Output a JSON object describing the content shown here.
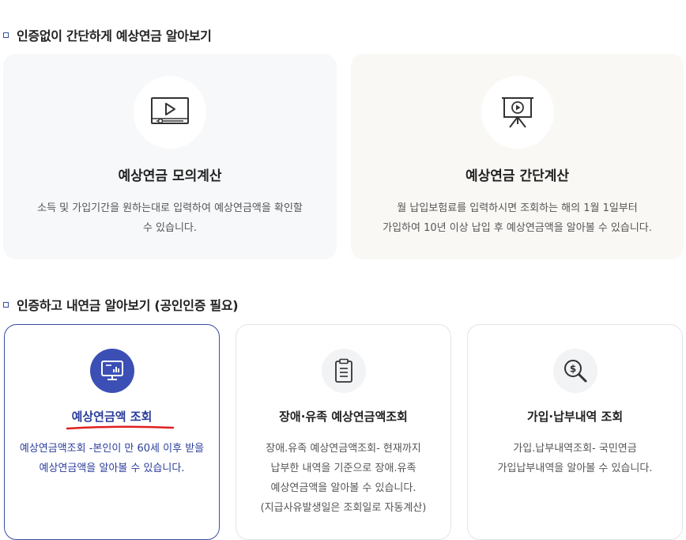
{
  "section1": {
    "title": "인증없이 간단하게 예상연금 알아보기",
    "cards": [
      {
        "title": "예상연금 모의계산",
        "desc_line1": "소득 및 가입기간을 원하는대로 입력하여 예상연금액을 확인할",
        "desc_line2": "수 있습니다.",
        "icon": "video-player-icon"
      },
      {
        "title": "예상연금 간단계산",
        "desc_line1": "월 납입보험료를 입력하시면 조회하는 해의 1월 1일부터",
        "desc_line2": "가입하여 10년 이상 납입 후 예상연금액을 알아볼 수 있습니다.",
        "icon": "presentation-board-icon"
      }
    ]
  },
  "section2": {
    "title": "인증하고 내연금 알아보기 (공인인증 필요)",
    "cards": [
      {
        "title": "예상연금액 조회",
        "desc_line1": "예상연금액조회 -본인이 만 60세 이후 받을",
        "desc_line2": "예상연금액을 알아볼 수 있습니다.",
        "icon": "monitor-chart-icon",
        "active": true
      },
      {
        "title": "장애·유족 예상연금액조회",
        "desc_line1": "장애.유족 예상연금액조회- 현재까지",
        "desc_line2": "납부한 내역을 기준으로 장애.유족",
        "desc_line3": "예상연금액을 알아볼 수 있습니다.",
        "desc_line4": "(지급사유발생일은 조회일로 자동계산)",
        "icon": "clipboard-icon"
      },
      {
        "title": "가입·납부내역 조회",
        "desc_line1": "가입.납부내역조회- 국민연금",
        "desc_line2": "가입납부내역을 알아볼 수 있습니다.",
        "icon": "money-search-icon"
      }
    ]
  },
  "colors": {
    "accent": "#3b4fb5",
    "accent_text": "#2b3d9c",
    "highlight_underline": "#e02020",
    "card_bg_gray": "#f7f8fa",
    "card_bg_beige": "#faf8f5"
  }
}
